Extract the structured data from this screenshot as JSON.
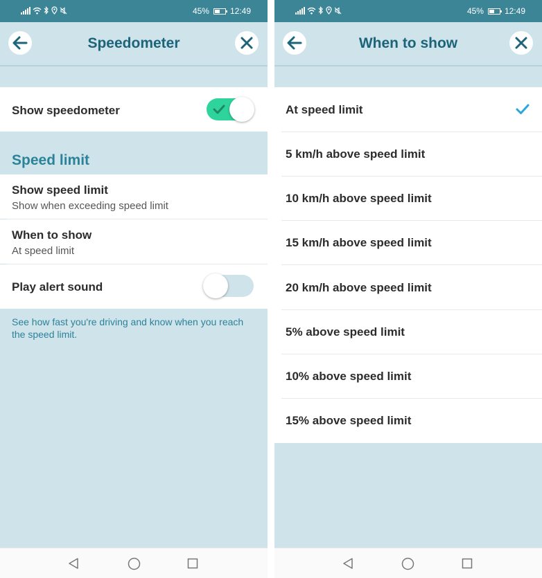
{
  "status_bar": {
    "battery": "45%",
    "time": "12:49"
  },
  "left": {
    "title": "Speedometer",
    "show_speedometer": {
      "label": "Show speedometer",
      "enabled": true
    },
    "section_title": "Speed limit",
    "show_speed_limit": {
      "title": "Show speed limit",
      "subtitle": "Show when exceeding speed limit"
    },
    "when_to_show": {
      "title": "When to show",
      "subtitle": "At speed limit"
    },
    "play_alert_sound": {
      "label": "Play alert sound",
      "enabled": false
    },
    "footer": "See how fast you're driving and know when you reach the speed limit."
  },
  "right": {
    "title": "When to show",
    "options": [
      {
        "label": "At speed limit",
        "selected": true
      },
      {
        "label": "5 km/h above speed limit",
        "selected": false
      },
      {
        "label": "10 km/h above speed limit",
        "selected": false
      },
      {
        "label": "15 km/h above speed limit",
        "selected": false
      },
      {
        "label": "20 km/h above speed limit",
        "selected": false
      },
      {
        "label": "5% above speed limit",
        "selected": false
      },
      {
        "label": "10% above speed limit",
        "selected": false
      },
      {
        "label": "15% above speed limit",
        "selected": false
      }
    ]
  },
  "icons": {
    "back": "arrow-left-icon",
    "close": "close-icon",
    "check": "checkmark-icon",
    "nav_back": "triangle-back-icon",
    "nav_home": "circle-home-icon",
    "nav_recents": "square-recents-icon"
  },
  "colors": {
    "status_bar": "#3b8597",
    "background": "#cfe3ea",
    "title": "#1c6479",
    "accent": "#2c8299",
    "toggle_on": "#2ed49b",
    "check": "#29a8d8"
  }
}
